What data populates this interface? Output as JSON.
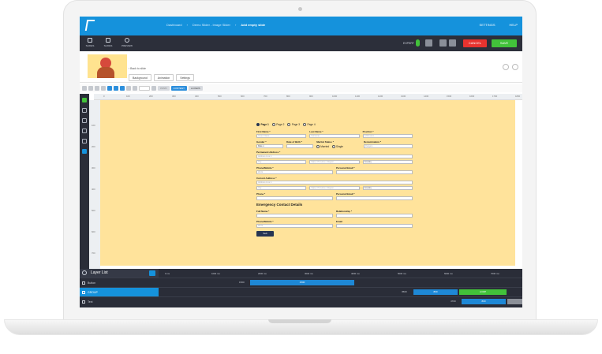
{
  "topbar": {
    "breadcrumbs": [
      "Dashboard",
      "Demo Slider - Image Slider"
    ],
    "current": "Add empty slide",
    "settings": "SETTINGS",
    "help": "HELP"
  },
  "toolbar": {
    "tools": [
      "SLIDES",
      "SLIDES",
      "PREVIEW"
    ],
    "expert": "EXPERT",
    "cancel": "CANCEL",
    "save": "SAVE"
  },
  "slide": {
    "back": "Back to slide",
    "chips": [
      "Background",
      "Animation",
      "Settings"
    ]
  },
  "options": {
    "blue_btn": "CONTENT",
    "grey_btn": "LAYERS"
  },
  "ruler": [
    "0",
    "100",
    "200",
    "300",
    "400",
    "500",
    "600",
    "700",
    "800",
    "900",
    "1000",
    "1100",
    "1200",
    "1300",
    "1400",
    "1500",
    "1600",
    "1700",
    "1800"
  ],
  "vruler": [
    "100",
    "200",
    "300",
    "400",
    "500",
    "600",
    "700"
  ],
  "form": {
    "steps": [
      "Page 1",
      "Page 2",
      "Page 3",
      "Page 4"
    ],
    "first_name": {
      "label": "First Name *",
      "ph": "Given Name"
    },
    "last_name": {
      "label": "Last Name *",
      "ph": "Surname"
    },
    "position": {
      "label": "Position *",
      "ph": "Addresses"
    },
    "gender": {
      "label": "Gender *",
      "value": "Male"
    },
    "dob": {
      "label": "Date of Birth *",
      "ph": ""
    },
    "marital": {
      "label": "Marital Status *",
      "opt1": "Married",
      "opt2": "Single"
    },
    "denomination": {
      "label": "Denomination *",
      "ph": "Religion"
    },
    "perm_address": {
      "label": "Permanent Address *",
      "ph": "Address Line 1",
      "city": "City",
      "state": "State / Province / Region",
      "country": "Country"
    },
    "phone_mobile": {
      "label": "Phone/Mobile *",
      "ph": "Work"
    },
    "personal_email": {
      "label": "Personal Email *"
    },
    "curr_address": {
      "label": "Current Address *",
      "ph": "Address Line 1",
      "city": "City",
      "state": "State / Province / Region",
      "country": "Country"
    },
    "phone": {
      "label": "Phone *"
    },
    "personal_email2": {
      "label": "Personal Email *"
    },
    "emergency": "Emergency Contact Details",
    "full_name": {
      "label": "Full Name *"
    },
    "relationship": {
      "label": "Relationship *"
    },
    "phone_mobile2": {
      "label": "Phone/Mobile *",
      "ph": "Work"
    },
    "email": {
      "label": "Email"
    },
    "submit": "Sub"
  },
  "timeline": {
    "title": "Layer List",
    "times": [
      "0 ms",
      "1000 ms",
      "2000 ms",
      "3000 ms",
      "4000 ms",
      "5000 ms",
      "6000 ms",
      "7000 ms"
    ],
    "layers": [
      "Button",
      "GROUP",
      "Text"
    ],
    "row1_num": "1500",
    "row1_bar": "1500",
    "row2_num": "3500",
    "row2_bar": "800",
    "row2_green": "LOOP",
    "row3_num": "4700",
    "row3_bar": "800",
    "row3_grey": "800"
  }
}
